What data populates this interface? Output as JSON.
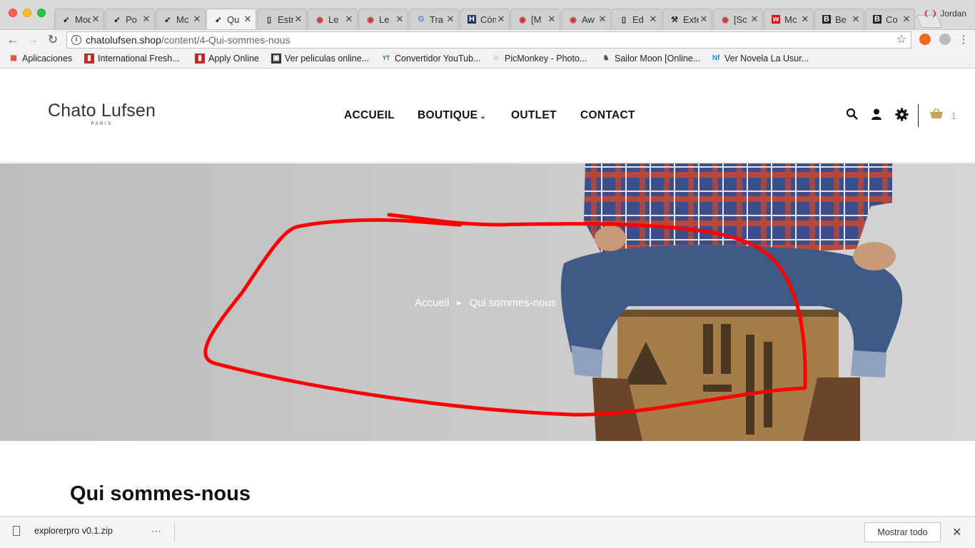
{
  "browser": {
    "tabs": [
      {
        "title": "Modu",
        "favicon": "ps"
      },
      {
        "title": "Po",
        "favicon": "ps"
      },
      {
        "title": "Mc",
        "favicon": "ps"
      },
      {
        "title": "Qu",
        "favicon": "ps",
        "active": true
      },
      {
        "title": "Estru",
        "favicon": "doc"
      },
      {
        "title": "Le",
        "favicon": "mascot"
      },
      {
        "title": "Le",
        "favicon": "mascot"
      },
      {
        "title": "Tra",
        "favicon": "translate"
      },
      {
        "title": "Cómo",
        "favicon": "H"
      },
      {
        "title": "[M",
        "favicon": "mascot"
      },
      {
        "title": "Aw",
        "favicon": "mascot"
      },
      {
        "title": "Ed",
        "favicon": "doc"
      },
      {
        "title": "Exten",
        "favicon": "wrench"
      },
      {
        "title": "[Sc",
        "favicon": "mascot"
      },
      {
        "title": "Mc",
        "favicon": "w"
      },
      {
        "title": "Be",
        "favicon": "B"
      },
      {
        "title": "Co",
        "favicon": "B"
      }
    ],
    "profile_name": "Jordan",
    "url_domain": "chatolufsen.shop",
    "url_path": "/content/4-Qui-sommes-nous",
    "bookmarks": [
      {
        "label": "Aplicaciones",
        "icon": "apps-grid"
      },
      {
        "label": "International Fresh...",
        "icon": "red-book"
      },
      {
        "label": "Apply Online",
        "icon": "red-book"
      },
      {
        "label": "Ver peliculas online...",
        "icon": "film"
      },
      {
        "label": "Convertidor YouTub...",
        "icon": "yt-mp3"
      },
      {
        "label": "PicMonkey - Photo...",
        "icon": "monkey"
      },
      {
        "label": "Sailor Moon [Online...",
        "icon": "cat"
      },
      {
        "label": "Ver Novela La Usur...",
        "icon": "nf"
      }
    ]
  },
  "site": {
    "logo_name": "Chato Lufsen",
    "logo_sub": "PARIS",
    "menu": [
      {
        "label": "ACCUEIL"
      },
      {
        "label": "BOUTIQUE",
        "dropdown": true
      },
      {
        "label": "OUTLET"
      },
      {
        "label": "CONTACT"
      }
    ],
    "cart_count": "1",
    "breadcrumb": {
      "home": "Accueil",
      "current": "Qui sommes-nous"
    },
    "page_title": "Qui sommes-nous"
  },
  "downloads": {
    "file_name": "explorerpro v0.1.zip",
    "more": "⋯",
    "show_all": "Mostrar todo"
  },
  "colors": {
    "annotation": "#ff0000",
    "cart_gold": "#c9a25a",
    "hero_bg": "#c5c5c5"
  }
}
